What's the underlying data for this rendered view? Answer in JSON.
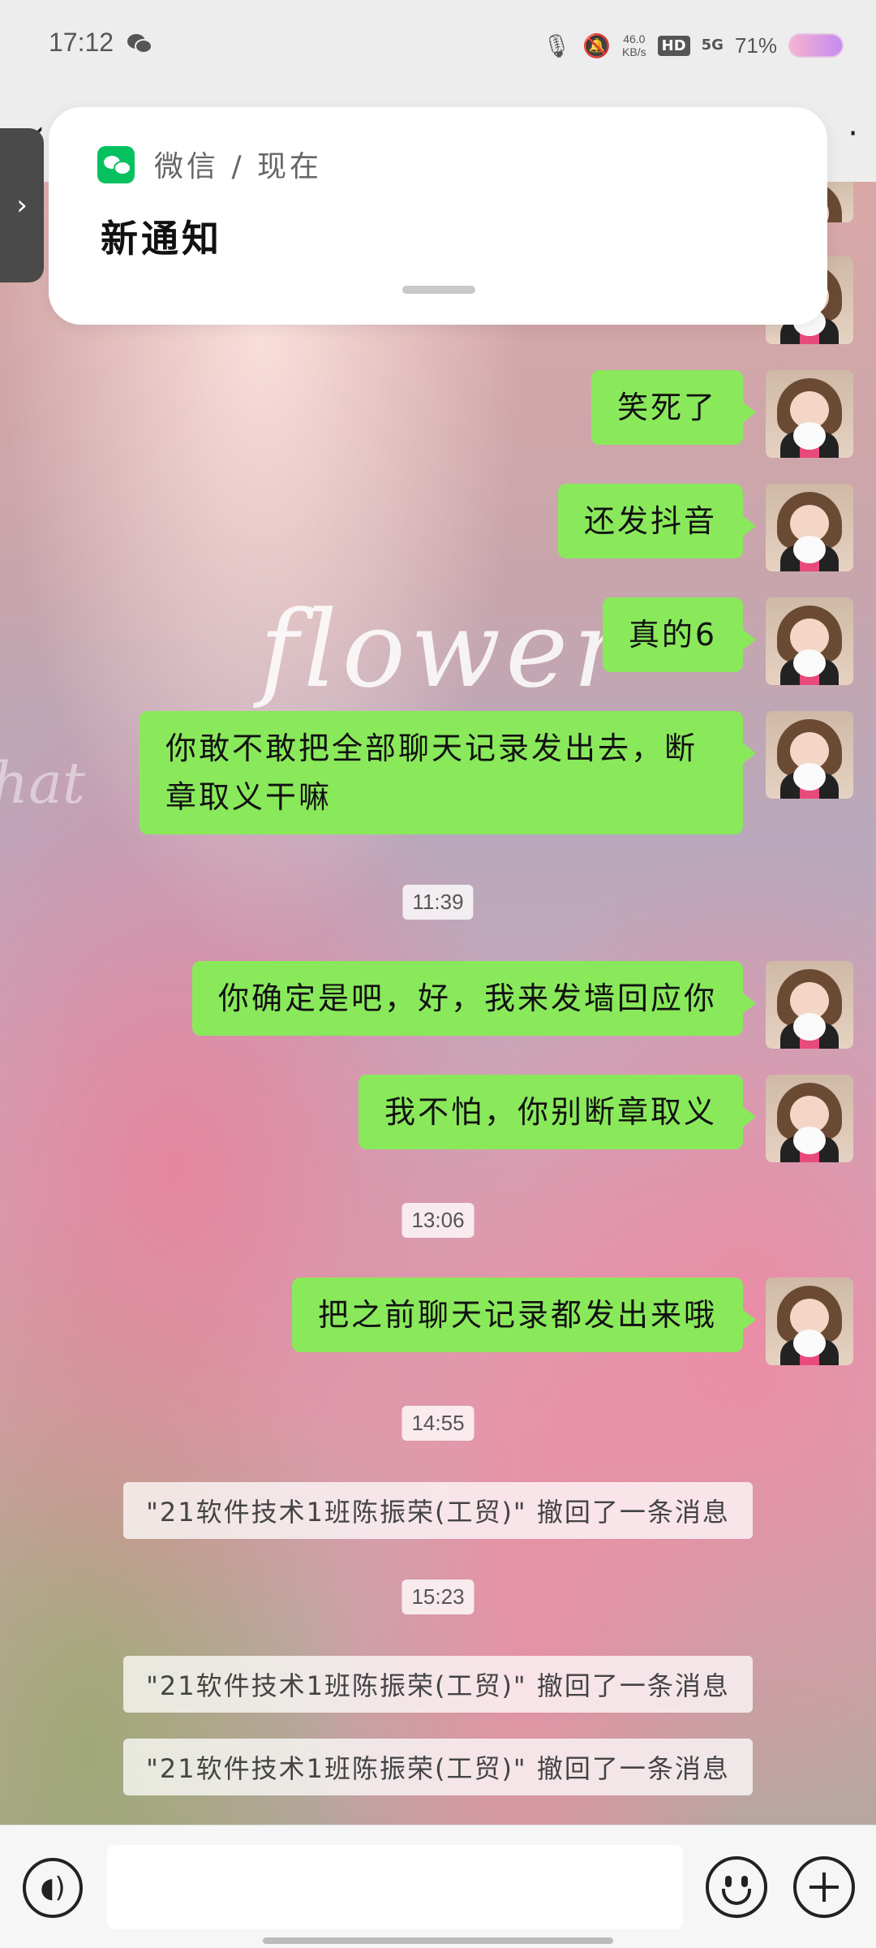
{
  "status_bar": {
    "time": "17:12",
    "net_speed_value": "46.0",
    "net_speed_unit": "KB/s",
    "hd": "HD",
    "signal": "5G",
    "battery": "71%"
  },
  "notification": {
    "source": "微信 / 现在",
    "title": "新通知"
  },
  "messages": [
    {
      "text": "笑死了"
    },
    {
      "text": "还发抖音"
    },
    {
      "text": "真的6"
    },
    {
      "text": "你敢不敢把全部聊天记录发出去，断章取义干嘛"
    },
    {
      "text": "你确定是吧，好，我来发墙回应你"
    },
    {
      "text": "我不怕，你别断章取义"
    },
    {
      "text": "把之前聊天记录都发出来哦"
    }
  ],
  "timestamps": [
    "11:39",
    "13:06",
    "14:55",
    "15:23"
  ],
  "system_messages": [
    "\"21软件技术1班陈振荣(工贸)\" 撤回了一条消息",
    "\"21软件技术1班陈振荣(工贸)\" 撤回了一条消息",
    "\"21软件技术1班陈振荣(工贸)\" 撤回了一条消息"
  ],
  "background_text": {
    "main": "flower",
    "script": "hat"
  },
  "input": {
    "value": ""
  },
  "colors": {
    "bubble": "#89e95b",
    "wechat_green": "#07c160"
  }
}
